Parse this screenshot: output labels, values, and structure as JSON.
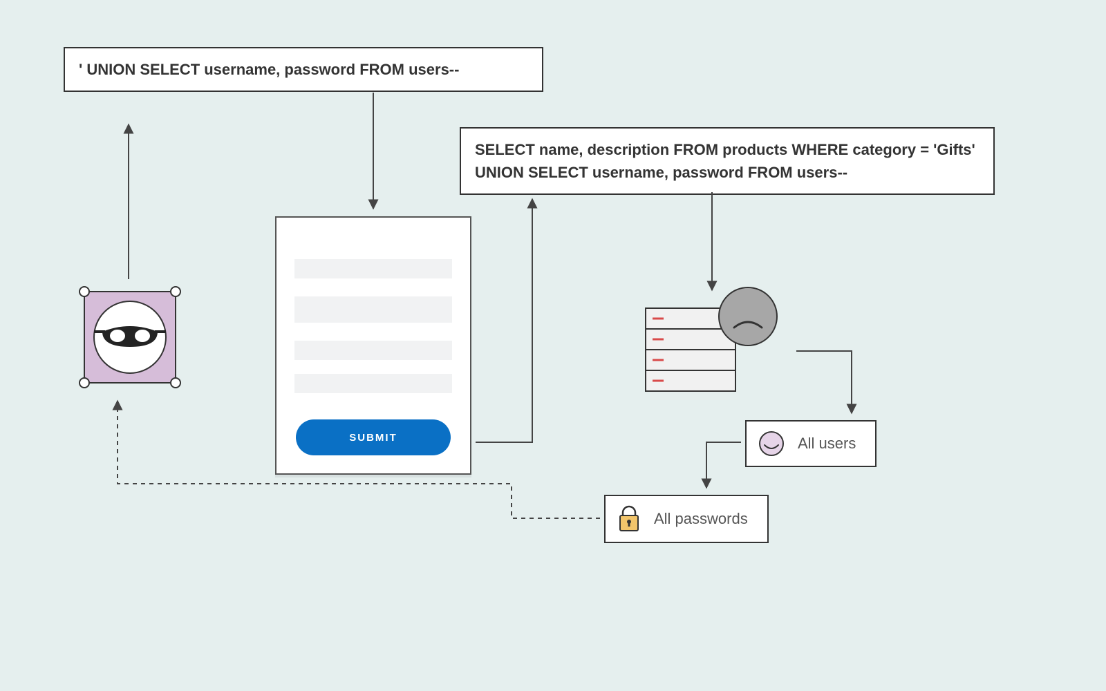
{
  "payload_box": {
    "text": "' UNION SELECT username, password FROM users--"
  },
  "query_box": {
    "text": "SELECT  name, description FROM products WHERE category = 'Gifts' UNION SELECT username, password FROM users--"
  },
  "form": {
    "submit_label": "SUBMIT"
  },
  "results": {
    "users_label": "All users",
    "passwords_label": "All passwords"
  },
  "colors": {
    "bg": "#e5efee",
    "accent": "#0a70c5",
    "attacker_fill": "#d6bdd9",
    "db_line_accent": "#d94a4a"
  }
}
